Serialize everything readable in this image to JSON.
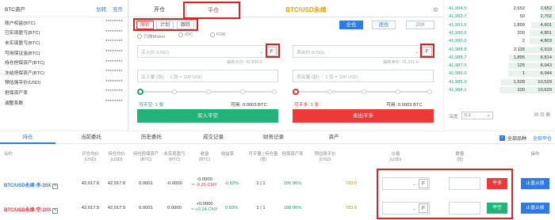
{
  "left": {
    "title": "BTC资产",
    "transfer": "划转",
    "recharge": "充币",
    "items": [
      {
        "label": "账户权益(BTC)",
        "value": "********"
      },
      {
        "label": "已实现盈亏(BTC)",
        "value": "********"
      },
      {
        "label": "未实现盈亏(BTC)",
        "value": "********"
      },
      {
        "label": "可用保证金(BTC)",
        "value": "********"
      },
      {
        "label": "持仓担保资产(BTC)",
        "value": "********"
      },
      {
        "label": "冻结担保资产(BTC)",
        "value": "********"
      },
      {
        "label": "预估强平价(USD)",
        "value": "********"
      },
      {
        "label": "担保资产率",
        "value": "********"
      },
      {
        "label": "调整系数",
        "value": "********"
      }
    ]
  },
  "center": {
    "tab_open": "开仓",
    "tab_close": "平仓",
    "title": "BTC/USD永续",
    "subtabs": [
      "限价",
      "计划",
      "跟踪"
    ],
    "lev_all": "全仓",
    "lev_each": "逐仓",
    "lev_x": "20X",
    "radios": [
      "只做Maker",
      "IOC",
      "FOK"
    ],
    "buy_price_ph": "买入价 (USD)",
    "sell_price_ph": "卖出价 (USD)",
    "buy_hint": "最新买价: 42,830.0",
    "sell_hint": "最新卖价: 41,151.0",
    "buy_qty_ph": "买入量 (张)",
    "buy_qty_hint": "1 张 = 100 USD",
    "sell_qty_ph": "卖出量 (张)",
    "sell_qty_hint": "1 张 = 100 USD",
    "buy_avail_label": "可平空: 1 张",
    "buy_avail_bal": "可用: 0.0003 BTC",
    "sell_avail_label": "可平多: 1 张",
    "sell_avail_bal": "可用: 0.0003 BTC",
    "buy_btn": "买入平空",
    "sell_btn": "卖出平多",
    "flag": "F"
  },
  "book": {
    "rows": [
      {
        "p": "41,994.5",
        "a": "2,652",
        "t": "2,652"
      },
      {
        "p": "41,992.7",
        "a": "50",
        "t": "2,702"
      },
      {
        "p": "41,991.6",
        "a": "1,899",
        "t": "4,601"
      },
      {
        "p": "41,990.6",
        "a": "200",
        "t": "4,801"
      },
      {
        "p": "41,990.0",
        "a": "2",
        "t": "4,803"
      },
      {
        "p": "41,988.8",
        "a": "2,116",
        "t": "6,919"
      },
      {
        "p": "41,988.7",
        "a": "1,895",
        "t": "8,814"
      },
      {
        "p": "41,987.5",
        "a": "125",
        "t": "8,943"
      },
      {
        "p": "41,986.0",
        "a": "1",
        "t": "8,944"
      },
      {
        "p": "41,985.9",
        "a": "1,528",
        "t": "10,529"
      },
      {
        "p": "41,984.1",
        "a": "100",
        "t": "10,629"
      }
    ],
    "depth_label": "深度",
    "depth_value": "0.1"
  },
  "bottom": {
    "tabs": [
      "持仓",
      "当前委托",
      "历史委托",
      "成交记录",
      "财务记录",
      "资产"
    ],
    "all_contracts": "全部品种",
    "close_all": "全部平仓",
    "headers": [
      "合约",
      "开仓均价",
      "持仓均价",
      "持仓担保资产",
      "未实现盈亏",
      "收益",
      "收益率",
      "可平量 | 持仓量",
      "担保资产率",
      "预估强平价",
      "价格",
      "数量",
      "操作"
    ],
    "header_units": [
      "",
      "(USD)",
      "(USD)",
      "(BTC)",
      "(BTC)",
      "(BTC)",
      "",
      "(张)",
      "",
      "(USD)",
      "(USD)",
      "(张)",
      ""
    ],
    "rows": [
      {
        "name": "BTC/USD永续-多-20X",
        "open": "42,017.6",
        "hold": "42,017.6",
        "margin": "0.0001",
        "upnl": "-0.0000",
        "pnl1": "-0.0000",
        "pnl2": "≈ -0.25 CNY",
        "ratio": "-0.83%",
        "qty": "1 | 1",
        "mratio": "186.96%",
        "liq": "783.6",
        "action": "平多",
        "stop": "止盈止损"
      },
      {
        "name": "BTC/USD永续-空-20X",
        "open": "42,017.5",
        "hold": "42,017.5",
        "margin": "0.0001",
        "upnl": "0.0000",
        "pnl1": "+0.0000",
        "pnl2": "≈ +0.24 CNY",
        "ratio": "0.83%",
        "qty": "1 | 1",
        "mratio": "188.96%",
        "liq": "783.6",
        "action": "平空",
        "stop": "止盈止损"
      }
    ]
  },
  "colors": {
    "green": "#1fa070",
    "red": "#e93030",
    "blue": "#2f7be6",
    "gold": "#f0a000"
  }
}
